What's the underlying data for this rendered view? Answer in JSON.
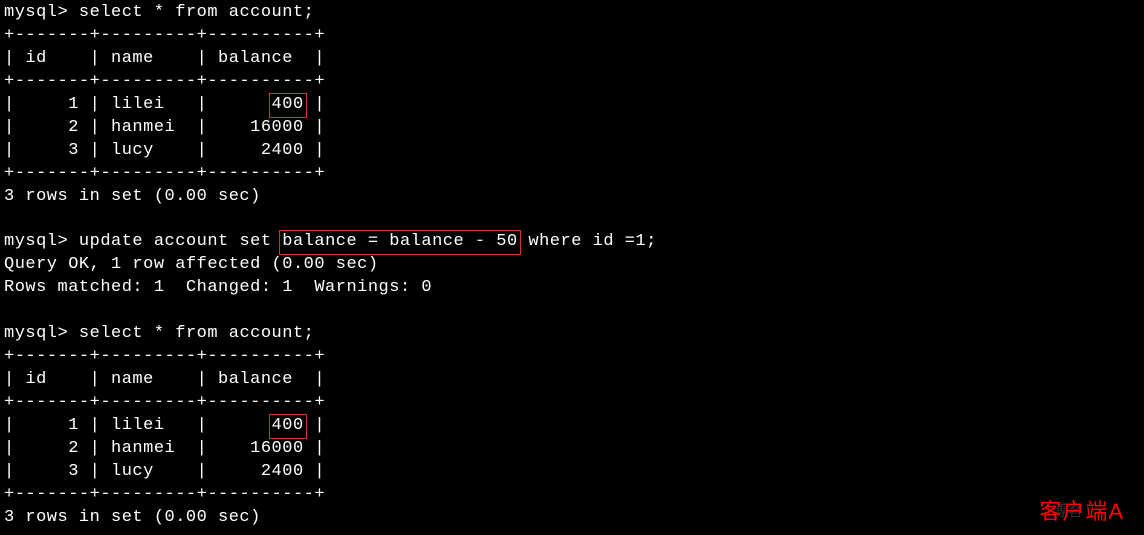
{
  "prompt": "mysql>",
  "query1": {
    "command": "select * from account;",
    "border_top": "+-------+---------+----------+",
    "header": "| id    | name    | balance  |",
    "border_mid": "+-------+---------+----------+",
    "rows": [
      {
        "id": "1",
        "name": "lilei",
        "balance": "400",
        "highlight": true
      },
      {
        "id": "2",
        "name": "hanmei",
        "balance": "16000",
        "highlight": false
      },
      {
        "id": "3",
        "name": "lucy",
        "balance": "2400",
        "highlight": false
      }
    ],
    "border_bot": "+-------+---------+----------+",
    "status": "3 rows in set (0.00 sec)"
  },
  "update": {
    "command_pre": "update account set ",
    "command_hl": "balance = balance - 50",
    "command_post": " where id =1;",
    "result1": "Query OK, 1 row affected (0.00 sec)",
    "result2": "Rows matched: 1  Changed: 1  Warnings: 0"
  },
  "query2": {
    "command": "select * from account;",
    "border_top": "+-------+---------+----------+",
    "header": "| id    | name    | balance  |",
    "border_mid": "+-------+---------+----------+",
    "rows": [
      {
        "id": "1",
        "name": "lilei",
        "balance": "400",
        "highlight": true
      },
      {
        "id": "2",
        "name": "hanmei",
        "balance": "16000",
        "highlight": false
      },
      {
        "id": "3",
        "name": "lucy",
        "balance": "2400",
        "highlight": false
      }
    ],
    "border_bot": "+-------+---------+----------+",
    "status": "3 rows in set (0.00 sec)"
  },
  "watermark_bg": "博客",
  "watermark": "客户端A"
}
